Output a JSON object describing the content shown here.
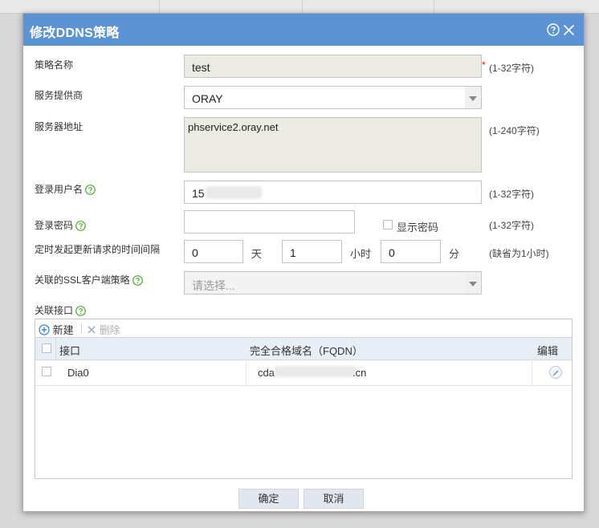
{
  "dialog": {
    "title": "修改DDNS策略",
    "close_symbol": "✕",
    "icons": [
      "help-icon",
      "close-icon",
      "question-icon",
      "plus-icon",
      "x-icon",
      "pencil-icon"
    ],
    "colors": {
      "titlebar": "#5b93d5",
      "required": "#e02020",
      "plus": "#3a87d6"
    }
  },
  "form": {
    "policy_name": {
      "label": "策略名称",
      "value": "test",
      "required_mark": "*",
      "hint": "(1-32字符)"
    },
    "provider": {
      "label": "服务提供商",
      "value": "ORAY"
    },
    "server_address": {
      "label": "服务器地址",
      "value": "phservice2.oray.net",
      "hint": "(1-240字符)"
    },
    "username": {
      "label": "登录用户名",
      "value": "15",
      "hint": "(1-32字符)"
    },
    "password": {
      "label": "登录密码",
      "value": "",
      "show_password_label": "显示密码",
      "hint": "(1-32字符)"
    },
    "interval": {
      "label": "定时发起更新请求的时间间隔",
      "days": "0",
      "days_unit": "天",
      "hours": "1",
      "hours_unit": "小时",
      "minutes": "0",
      "minutes_unit": "分",
      "hint": "(缺省为1小时)"
    },
    "ssl_policy": {
      "label": "关联的SSL客户端策略",
      "placeholder": "请选择..."
    },
    "interfaces": {
      "label": "关联接口"
    }
  },
  "interfaces_panel": {
    "toolbar": {
      "new_label": "新建",
      "delete_label": "删除"
    },
    "columns": [
      "接口",
      "完全合格域名（FQDN）",
      "编辑"
    ],
    "rows": [
      {
        "interface": "Dia0",
        "fqdn_prefix": "cda",
        "fqdn_suffix": ".cn"
      }
    ]
  },
  "footer": {
    "ok_label": "确定",
    "cancel_label": "取消"
  }
}
